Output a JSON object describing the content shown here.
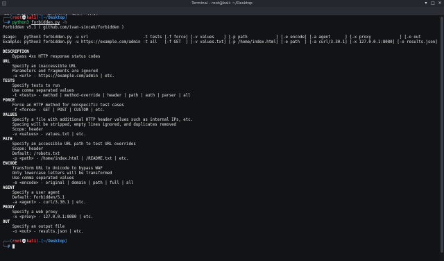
{
  "window": {
    "title": "Terminal - root@kali: ~/Desktop",
    "minimize_glyph": "▾",
    "maximize_glyph": "□",
    "close_glyph": "✕",
    "icon": "terminal-app-icon"
  },
  "menu": [
    "File",
    "Edit",
    "View",
    "Terminal",
    "Tabs",
    "Help"
  ],
  "prompt": {
    "top_left": "┌──(",
    "user": "root",
    "skull": "💀",
    "host": "kali",
    "mid": ")-[",
    "dir": "~/Desktop",
    "end": "]",
    "bottom_left": "└─",
    "symbol": "#"
  },
  "command": {
    "interpreter": "python3",
    "file": "forbidden.py",
    "suggestion": " -h"
  },
  "output": [
    "Forbidden v5.1 ( github.com/ivan-sincek/forbidden )",
    "",
    "Usage:   python3 forbidden.py -u url                       -t tests [-f force] [-v values    ] [-p path            ] [-e encode] [-a agent      ] [-x proxy            ] [-o out         ]",
    "Example: python3 forbidden.py -u https://example.com/admin -t all   [-f GET  ] [-v values.txt] [-p /home/index.html] [-e path  ] [-a curl/3.30.1] [-x 127.0.0.1:8080] [-o results.json]",
    "",
    "DESCRIPTION",
    "    Bypass 4xx HTTP response status codes",
    "URL",
    "    Specify an inaccessible URL",
    "    Parameters and fragments are ignored",
    "    -u <url> - https://example.com/admin | etc.",
    "TESTS",
    "    Specify tests to run",
    "    Use comma separated values",
    "    -t <tests> - method | method-override | header | path | auth | parser | all",
    "FORCE",
    "    Force an HTTP method for nonspecific test cases",
    "    -f <force> - GET | POST | CUSTOM | etc.",
    "VALUES",
    "    Specify a file with additional HTTP header values such as internal IPs, etc.",
    "    Spacing will be stripped, empty lines ignored, and duplicates removed",
    "    Scope: header",
    "    -v <values> - values.txt | etc.",
    "PATH",
    "    Specify an accessible URL path to test URL overrides",
    "    Scope: header",
    "    Default: /robots.txt",
    "    -p <path> - /home/index.html | /README.txt | etc.",
    "ENCODE",
    "    Transform URL to Unicode to bypass WAF",
    "    Only lowercase letters will be transformed",
    "    Use comma separated values",
    "    -e <encode> - original | domain | path | full | all",
    "AGENT",
    "    Specify a user agent",
    "    Default: Forbidden/5.1",
    "    -a <agent> - curl/3.30.1 | etc.",
    "PROXY",
    "    Specify a web proxy",
    "    -x <proxy> - 127.0.0.1:8080 | etc.",
    "OUT",
    "    Specify an output file",
    "    -o <out> - results.json | etc.",
    ""
  ],
  "headings": [
    "DESCRIPTION",
    "URL",
    "TESTS",
    "FORCE",
    "VALUES",
    "PATH",
    "ENCODE",
    "AGENT",
    "PROXY",
    "OUT"
  ]
}
